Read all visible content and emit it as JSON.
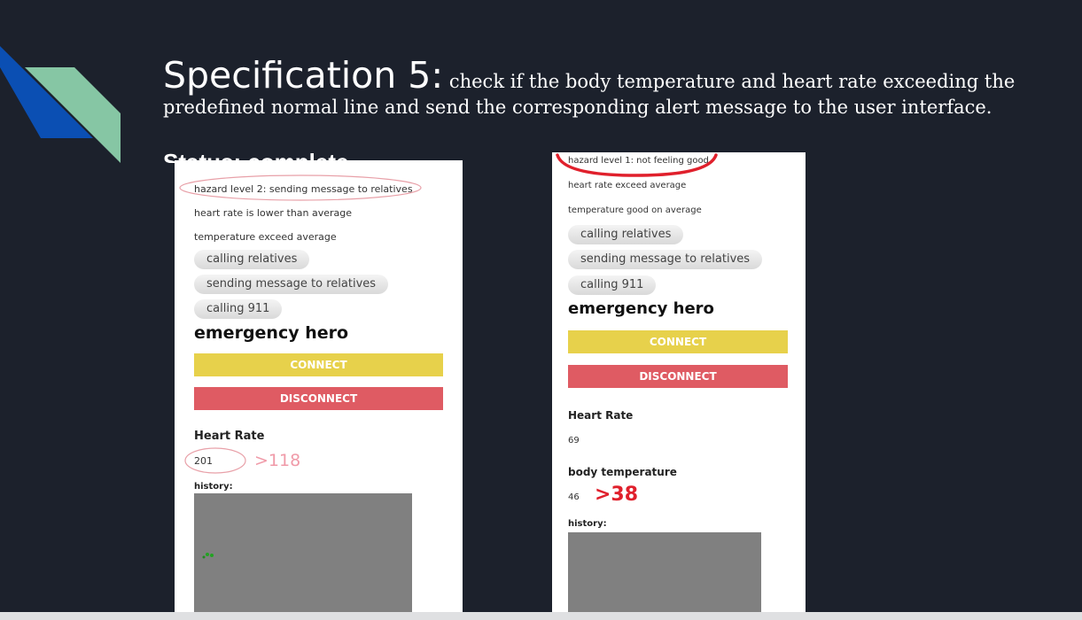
{
  "slide": {
    "heading_spec": "Specification 5:",
    "heading_desc": " check if the body temperature and heart rate exceeding the predefined normal line and send the corresponding alert message to the user interface.",
    "status_line": "Status: complete"
  },
  "screen_left": {
    "hazard": "hazard level 2: sending message to relatives",
    "heart_status": "heart rate is lower than average",
    "temp_status": "temperature exceed average",
    "actions": [
      "calling relatives",
      "sending message to relatives",
      "calling 911"
    ],
    "app_title": "emergency hero",
    "connect_label": "CONNECT",
    "disconnect_label": "DISCONNECT",
    "heart_rate_label": "Heart Rate",
    "heart_rate_value": "201",
    "history_label": "history:",
    "annotation": ">118"
  },
  "screen_right": {
    "hazard": "hazard level 1: not feeling good",
    "heart_status": "heart rate exceed average",
    "temp_status": "temperature good on average",
    "actions": [
      "calling relatives",
      "sending message to relatives",
      "calling 911"
    ],
    "app_title": "emergency hero",
    "connect_label": "CONNECT",
    "disconnect_label": "DISCONNECT",
    "heart_rate_label": "Heart Rate",
    "heart_rate_value": "69",
    "body_temp_label": "body temperature",
    "body_temp_value": "46",
    "history_label": "history:",
    "annotation": ">38"
  },
  "colors": {
    "background": "#1c212c",
    "connect": "#e7d14b",
    "disconnect": "#df5b63",
    "history_panel": "#808080",
    "annotation_red": "#e0202c"
  },
  "icons": [
    "stripe-blue-decoration",
    "stripe-green-decoration"
  ]
}
